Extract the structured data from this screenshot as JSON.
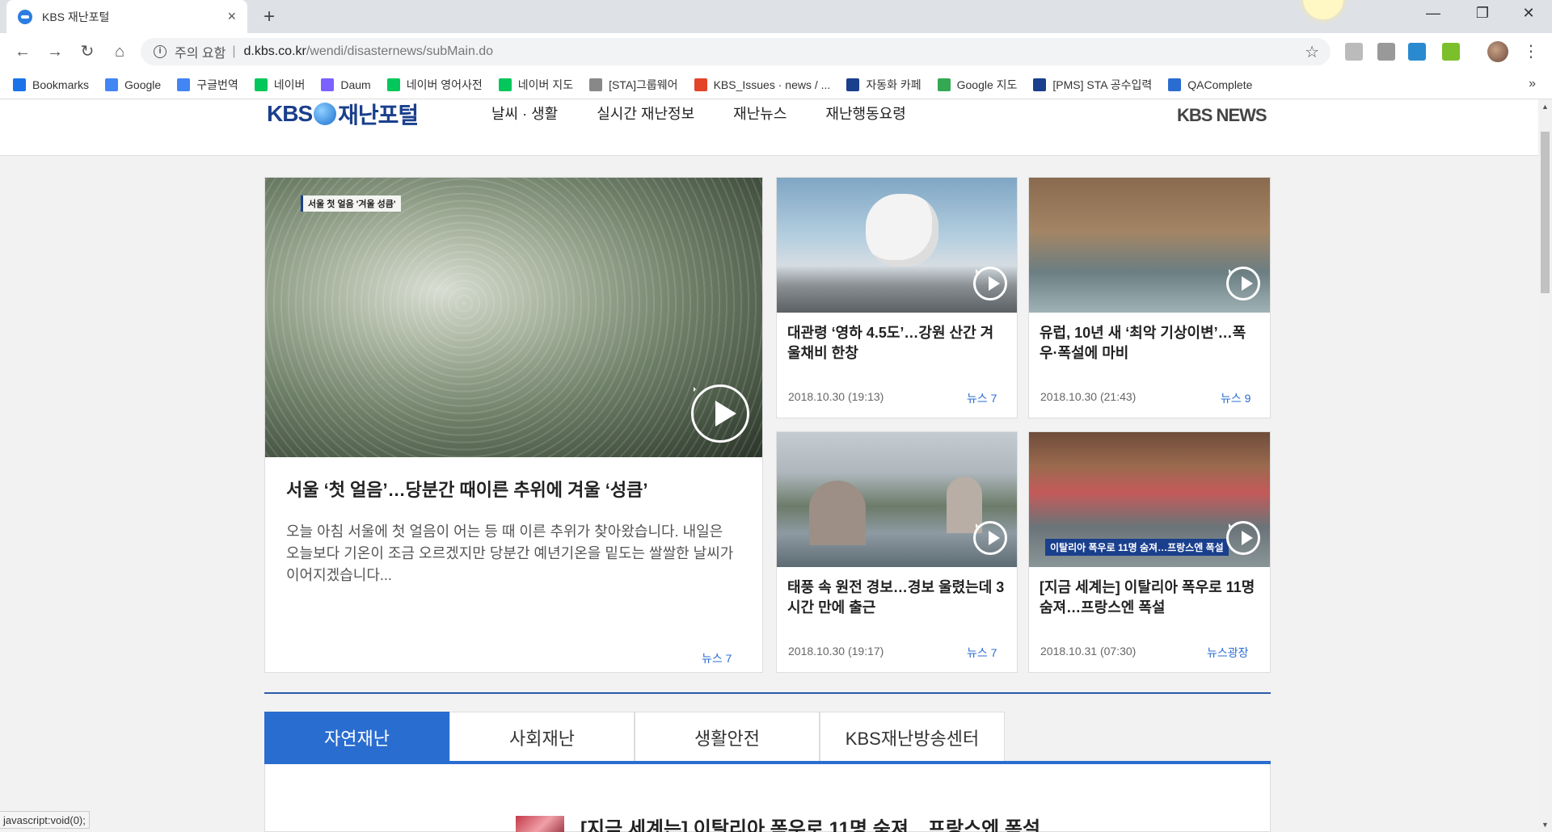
{
  "browser": {
    "tab_title": "KBS 재난포털",
    "tab_close": "×",
    "new_tab": "+",
    "url_security": "주의 요함",
    "url_sep": "|",
    "url_host": "d.kbs.co.kr",
    "url_path": "/wendi/disasternews/subMain.do",
    "window_controls": [
      "—",
      "❐",
      "✕"
    ],
    "status_text": "javascript:void(0);"
  },
  "bookmarks": [
    {
      "label": "Bookmarks",
      "icon": "star-icon",
      "color": "#1a73e8"
    },
    {
      "label": "Google",
      "icon": "google-icon",
      "color": "#4285f4"
    },
    {
      "label": "구글번역",
      "icon": "translate-icon",
      "color": "#4285f4"
    },
    {
      "label": "네이버",
      "icon": "naver-icon",
      "color": "#03c75a"
    },
    {
      "label": "Daum",
      "icon": "daum-icon",
      "color": "#7b61ff"
    },
    {
      "label": "네이버 영어사전",
      "icon": "naver-dict-icon",
      "color": "#03c75a"
    },
    {
      "label": "네이버 지도",
      "icon": "naver-map-icon",
      "color": "#03c75a"
    },
    {
      "label": "[STA]그룹웨어",
      "icon": "page-icon",
      "color": "#888888"
    },
    {
      "label": "KBS_Issues · news / ...",
      "icon": "gitlab-icon",
      "color": "#e24329"
    },
    {
      "label": "자동화 카페",
      "icon": "sta-icon",
      "color": "#1a3f8c"
    },
    {
      "label": "Google 지도",
      "icon": "google-maps-icon",
      "color": "#34a853"
    },
    {
      "label": "[PMS] STA 공수입력",
      "icon": "pms-icon",
      "color": "#1a3f8c"
    },
    {
      "label": "QAComplete",
      "icon": "qacomplete-icon",
      "color": "#2a6dd0"
    }
  ],
  "site": {
    "logo_kbs": "KBS",
    "logo_portal": "재난포털",
    "nav": [
      "날씨 · 생활",
      "실시간 재난정보",
      "재난뉴스",
      "재난행동요령"
    ],
    "kbs_news": "KBS NEWS"
  },
  "featured": {
    "badge": "서울 첫 얼음 '겨울 성큼'",
    "title": "서울 ‘첫 얼음’…당분간 때이른 추위에 겨울 ‘성큼’",
    "desc": "오늘 아침 서울에 첫 얼음이 어는 등 때 이른 추위가 찾아왔습니다. 내일은 오늘보다 기온이 조금 오르겠지만 당분간 예년기온을 밑도는 쌀쌀한 날씨가 이어지겠습니다...",
    "source": "뉴스 7"
  },
  "cards": [
    {
      "title": "대관령 ‘영하 4.5도’…강원 산간 겨울채비 한창",
      "date": "2018.10.30 (19:13)",
      "source": "뉴스 7"
    },
    {
      "title": "유럽, 10년 새 ‘최악 기상이변’…폭우·폭설에 마비",
      "date": "2018.10.30 (21:43)",
      "source": "뉴스 9"
    },
    {
      "title": "태풍 속 원전 경보…경보 울렸는데 3시간 만에 출근",
      "date": "2018.10.30 (19:17)",
      "source": "뉴스 7"
    },
    {
      "title": "[지금 세계는] 이탈리아 폭우로 11명 숨져…프랑스엔 폭설",
      "date": "2018.10.31 (07:30)",
      "source": "뉴스광장",
      "overlay": "이탈리아 폭우로 11명 숨져…프랑스엔 폭설"
    }
  ],
  "category_tabs": [
    "자연재난",
    "사회재난",
    "생활안전",
    "KBS재난방송센터"
  ],
  "list_item": {
    "title": "[지금 세계는] 이탈리아 폭우로 11명 숨져…프랑스엔 폭설"
  },
  "colors": {
    "accent": "#2a6dd0",
    "brand": "#1a3f8c"
  }
}
